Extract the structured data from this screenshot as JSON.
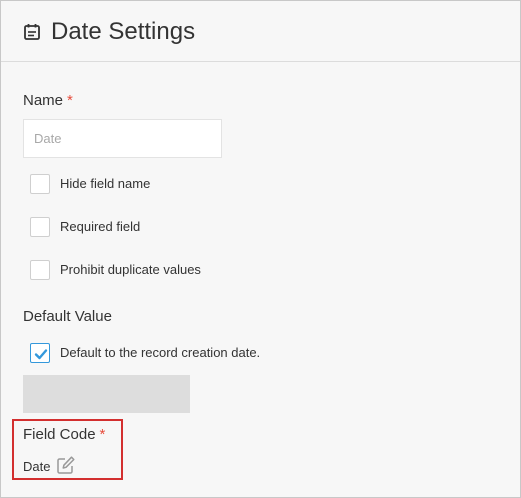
{
  "header": {
    "title": "Date Settings",
    "icon": "calendar-icon"
  },
  "name_field": {
    "label": "Name",
    "required_mark": "*",
    "value": "",
    "placeholder": "Date"
  },
  "options": [
    {
      "label": "Hide field name",
      "checked": false
    },
    {
      "label": "Required field",
      "checked": false
    },
    {
      "label": "Prohibit duplicate values",
      "checked": false
    }
  ],
  "default_value": {
    "label": "Default Value",
    "checkbox_label": "Default to the record creation date.",
    "checked": true
  },
  "field_code": {
    "label": "Field Code",
    "required_mark": "*",
    "value": "Date",
    "edit_icon": "pencil-edit-icon"
  },
  "colors": {
    "accent": "#3498db",
    "required": "#e74c3c",
    "highlight": "#d32f2f",
    "background": "#f7f7f7"
  }
}
